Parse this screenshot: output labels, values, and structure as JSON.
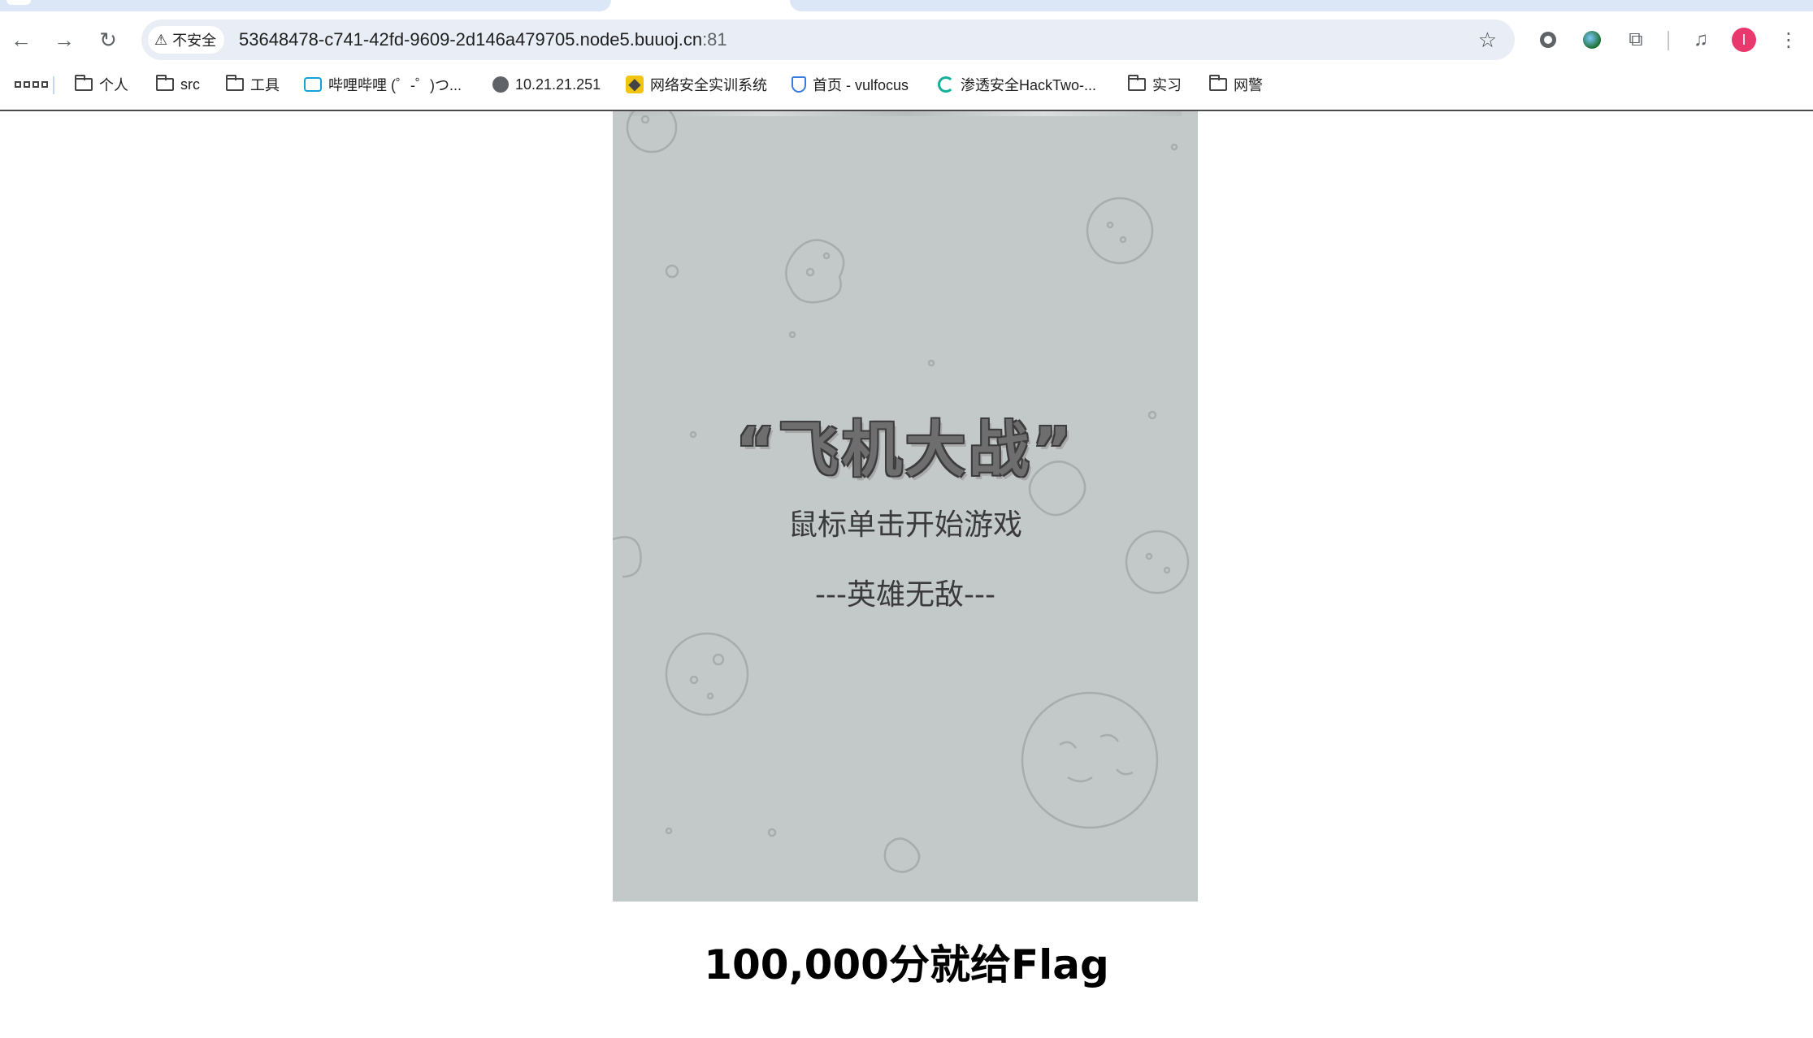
{
  "browser": {
    "address": {
      "security_label": "不安全",
      "url_host": "53648478-c741-42fd-9609-2d146a479705.node5.buuoj.cn",
      "url_port": ":81"
    },
    "profile_initial": "I",
    "bookmarks": [
      {
        "label": "个人",
        "icon": "folder-icon"
      },
      {
        "label": "src",
        "icon": "folder-icon"
      },
      {
        "label": "工具",
        "icon": "folder-icon"
      },
      {
        "label": "哔哩哔哩 (゜-゜)つ...",
        "icon": "bilibili-icon"
      },
      {
        "label": "10.21.21.251",
        "icon": "globe-icon"
      },
      {
        "label": "网络安全实训系统",
        "icon": "yellow-site-icon"
      },
      {
        "label": "首页 - vulfocus",
        "icon": "shield-icon"
      },
      {
        "label": "渗透安全HackTwo-...",
        "icon": "spinner-icon"
      },
      {
        "label": "实习",
        "icon": "folder-icon"
      },
      {
        "label": "网警",
        "icon": "folder-icon"
      }
    ]
  },
  "game": {
    "title": "“飞机大战”",
    "start_hint": "鼠标单击开始游戏",
    "mode_label": "---英雄无敌---",
    "background_color": "#c3c8c8"
  },
  "page": {
    "heading": "100,000分就给Flag"
  }
}
